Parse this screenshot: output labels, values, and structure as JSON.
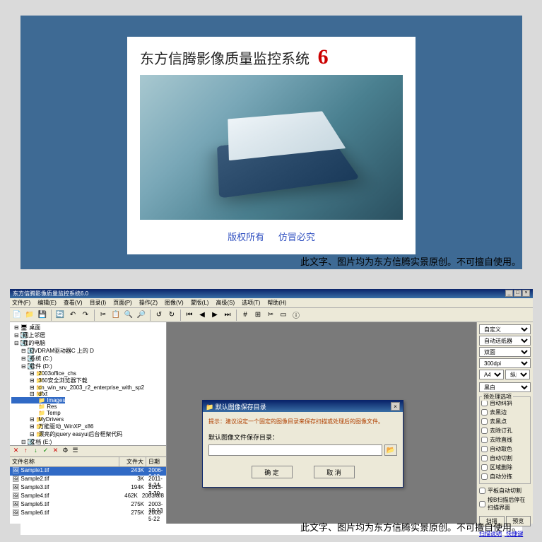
{
  "splash": {
    "title": "东方信腾影像质量监控系统",
    "version": "6",
    "copyright1": "版权所有",
    "copyright2": "仿冒必究"
  },
  "watermark": "此文字、图片均为东方信腾实景原创。不可擅自使用。",
  "app": {
    "title": "东方信腾影像质量监控系统6.0",
    "menus": [
      "文件(F)",
      "编辑(E)",
      "查看(V)",
      "目录(I)",
      "页面(P)",
      "操作(Z)",
      "图像(V)",
      "蒙版(L)",
      "高级(S)",
      "选项(T)",
      "帮助(H)"
    ]
  },
  "tree": {
    "root": "桌面",
    "items": [
      {
        "l": 0,
        "t": "网上邻居"
      },
      {
        "l": 0,
        "t": "我的电脑"
      },
      {
        "l": 1,
        "t": "DVDRAM驱动器C 上的 D"
      },
      {
        "l": 1,
        "t": "系统 (C:)"
      },
      {
        "l": 1,
        "t": "软件 (D:)"
      },
      {
        "l": 2,
        "t": "2003office_chs"
      },
      {
        "l": 2,
        "t": "360安全浏览器下载"
      },
      {
        "l": 2,
        "t": "cn_win_srv_2003_r2_enterprise_with_sp2"
      },
      {
        "l": 2,
        "t": "dfxt"
      },
      {
        "l": 3,
        "t": "Images",
        "sel": true
      },
      {
        "l": 3,
        "t": "Res"
      },
      {
        "l": 3,
        "t": "Temp"
      },
      {
        "l": 2,
        "t": "MyDrivers"
      },
      {
        "l": 2,
        "t": "万能驱动_WinXP_x86"
      },
      {
        "l": 2,
        "t": "漂亮的jquery easyui后台框架代码"
      },
      {
        "l": 1,
        "t": "文档 (E:)"
      }
    ]
  },
  "filehdr": {
    "c1": "文件名称",
    "c2": "文件大小",
    "c3": "日期"
  },
  "files": [
    {
      "name": "Sample1.tif",
      "size": "243K",
      "date": "2006-6-18",
      "sel": true
    },
    {
      "name": "Sample2.tif",
      "size": "3K",
      "date": "2011-8-24"
    },
    {
      "name": "Sample3.tif",
      "size": "194K",
      "date": "2013-3-30"
    },
    {
      "name": "Sample4.tif",
      "size": "462K",
      "date": "2003/8/8"
    },
    {
      "name": "Sample5.tif",
      "size": "275K",
      "date": "2003-10-13"
    },
    {
      "name": "Sample6.tif",
      "size": "275K",
      "date": "2003-5-22"
    }
  ],
  "dialog": {
    "title": "默认图像保存目录",
    "hint": "提示：建议设定一个固定的图像目录来保存扫描或处理后的图像文件。",
    "label": "默认图像文件保存目录：",
    "ok": "确 定",
    "cancel": "取 消"
  },
  "right": {
    "sel1": "自定义",
    "sel2": "自动送纸器",
    "sel3": "双面",
    "sel4": "300dpi",
    "sel5a": "A4",
    "sel5b": "纵向",
    "sel6": "黑白",
    "group1_title": "预处理选项",
    "checks": [
      "自动纠斜",
      "去黑边",
      "去黑点",
      "去除订孔",
      "去除直线",
      "自动取色",
      "自动切割",
      "区域删除",
      "自动分拣"
    ],
    "chk_flat": "平板自动切割",
    "chk_stop": "按B扫描后停在扫描界面",
    "btn_scan": "扫描",
    "btn_preview": "预览",
    "link1": "扫描说明",
    "link2": "快捷键"
  }
}
